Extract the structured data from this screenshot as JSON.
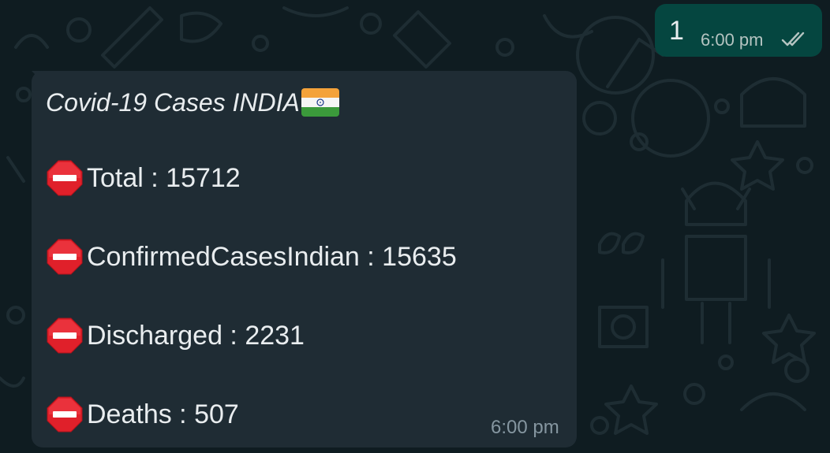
{
  "outgoing": {
    "text": "1",
    "time": "6:00 pm",
    "status_icon": "double-check-icon"
  },
  "incoming": {
    "title": "Covid-19 Cases INDIA",
    "title_icon": "india-flag-icon",
    "stats": [
      {
        "icon": "stop-sign-icon",
        "text": "Total : 15712"
      },
      {
        "icon": "stop-sign-icon",
        "text": "ConfirmedCasesIndian : 15635"
      },
      {
        "icon": "stop-sign-icon",
        "text": "Discharged : 2231"
      },
      {
        "icon": "stop-sign-icon",
        "text": "Deaths : 507"
      }
    ],
    "time": "6:00 pm"
  },
  "colors": {
    "background": "#0f1c21",
    "outgoing_bubble": "#054640",
    "incoming_bubble": "#1f2c34",
    "text": "#e9edef",
    "stop_sign": "#e0202a"
  }
}
